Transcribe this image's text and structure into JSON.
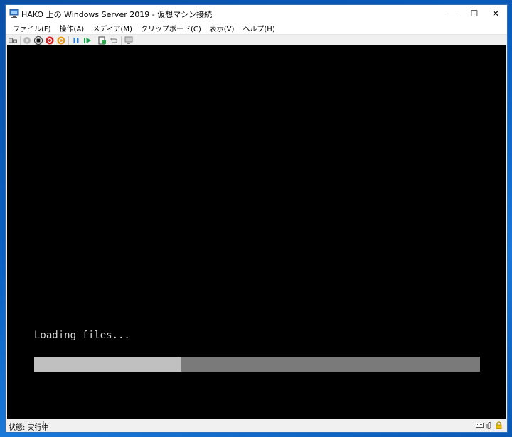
{
  "window": {
    "title": "HAKO 上の Windows Server 2019 - 仮想マシン接続",
    "controls": {
      "minimize": "—",
      "maximize": "☐",
      "close": "✕"
    }
  },
  "menu": {
    "items": [
      {
        "label": "ファイル(F)"
      },
      {
        "label": "操作(A)"
      },
      {
        "label": "メディア(M)"
      },
      {
        "label": "クリップボード(C)"
      },
      {
        "label": "表示(V)"
      },
      {
        "label": "ヘルプ(H)"
      }
    ]
  },
  "toolbar": {
    "buttons": [
      {
        "icon": "ctrl-alt-del-icon"
      },
      {
        "icon": "start-icon"
      },
      {
        "icon": "turn-off-icon"
      },
      {
        "icon": "shut-down-icon"
      },
      {
        "icon": "save-icon"
      },
      {
        "icon": "pause-icon"
      },
      {
        "icon": "resume-icon"
      },
      {
        "icon": "checkpoint-icon"
      },
      {
        "icon": "revert-icon"
      },
      {
        "icon": "enhanced-session-icon"
      }
    ]
  },
  "screen": {
    "loading_text": "Loading files...",
    "progress": 0.33
  },
  "status": {
    "text": "状態: 実行中",
    "icons": [
      "keyboard-icon",
      "attachment-icon",
      "lock-icon"
    ]
  },
  "colors": {
    "desktop": "#0a5fc0",
    "screen_bg": "#000000",
    "progress_track": "#7a7a7a",
    "progress_fill": "#c0c0c0",
    "loading_text": "#d8d8d8"
  }
}
